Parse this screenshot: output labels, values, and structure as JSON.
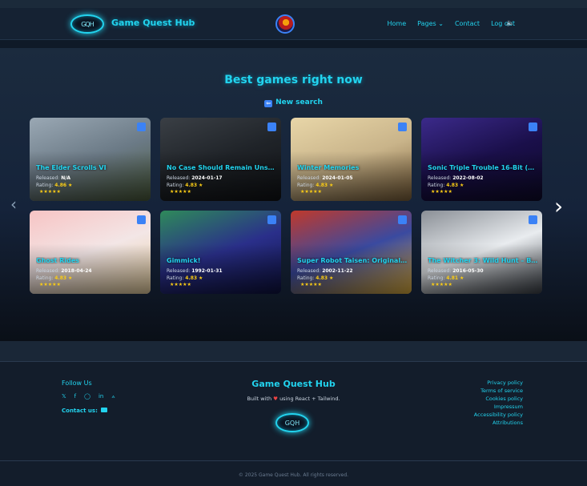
{
  "header": {
    "logo_text": "GQH",
    "brand": "Game Quest Hub",
    "nav": [
      "Home",
      "Pages",
      "Contact",
      "Log out"
    ],
    "pages_chevron": "⌄",
    "sound_icon": "🔈"
  },
  "hero": {
    "title": "Best games right now",
    "new_search": "New search",
    "prev_arrow": "‹",
    "next_arrow": "›"
  },
  "games": [
    {
      "title": "The Elder Scrolls VI",
      "released_label": "Released:",
      "released": "N/A",
      "rating_label": "Rating:",
      "rating": "4.86",
      "star": "★",
      "stars": "★★★★★",
      "colors": [
        "#6b7a86",
        "#9aa8b4",
        "#4a5a3a"
      ]
    },
    {
      "title": "No Case Should Remain Unso…",
      "released_label": "Released:",
      "released": "2024-01-17",
      "rating_label": "Rating:",
      "rating": "4.83",
      "star": "★",
      "stars": "★★★★★",
      "colors": [
        "#1f2328",
        "#3a3f45",
        "#101215"
      ]
    },
    {
      "title": "Winter Memories",
      "released_label": "Released:",
      "released": "2024-01-05",
      "rating_label": "Rating:",
      "rating": "4.83",
      "star": "★",
      "stars": "★★★★★",
      "colors": [
        "#c9b48a",
        "#e8d6a8",
        "#7a5f3a"
      ]
    },
    {
      "title": "Sonic Triple Trouble 16-Bit (N…",
      "released_label": "Released:",
      "released": "2022-08-02",
      "rating_label": "Rating:",
      "rating": "4.83",
      "star": "★",
      "stars": "★★★★★",
      "colors": [
        "#1a0f4a",
        "#3b2a8a",
        "#0e0a2a"
      ]
    },
    {
      "title": "Ghost Rides",
      "released_label": "Released:",
      "released": "2018-04-24",
      "rating_label": "Rating:",
      "rating": "4.83",
      "star": "★",
      "stars": "★★★★★",
      "colors": [
        "#f3e6e6",
        "#f7c4c4",
        "#e8d0a0"
      ]
    },
    {
      "title": "Gimmick!",
      "released_label": "Released:",
      "released": "1992-01-31",
      "rating_label": "Rating:",
      "rating": "4.83",
      "star": "★",
      "stars": "★★★★★",
      "colors": [
        "#2a2f8a",
        "#2e8a5a",
        "#0e1240"
      ]
    },
    {
      "title": "Super Robot Taisen: Original …",
      "released_label": "Released:",
      "released": "2002-11-22",
      "rating_label": "Rating:",
      "rating": "4.83",
      "star": "★",
      "stars": "★★★★★",
      "colors": [
        "#3a4aa0",
        "#c0392b",
        "#e2b13c"
      ]
    },
    {
      "title": "The Witcher 3: Wild Hunt – Bl…",
      "released_label": "Released:",
      "released": "2016-05-30",
      "rating_label": "Rating:",
      "rating": "4.81",
      "star": "★",
      "stars": "★★★★★",
      "colors": [
        "#e9ecef",
        "#8a8f96",
        "#3a3f46"
      ]
    }
  ],
  "footer": {
    "follow": "Follow Us",
    "socials": [
      "𝕏",
      "f",
      "◯",
      "in",
      "⟑"
    ],
    "contact": "Contact us:",
    "brand": "Game Quest Hub",
    "built_prefix": "Built with",
    "heart": "♥",
    "built_suffix": "using React + Tailwind.",
    "logo_text": "GQH",
    "policies": [
      "Privacy policy",
      "Terms of service",
      "Cookies policy",
      "Impressum",
      "Accessibility policy",
      "Attributions"
    ],
    "copyright": "© 2025 Game Quest Hub. All rights reserved."
  },
  "colors": {
    "accent": "#22d3ee",
    "background": "#0f1a28",
    "rating": "#facc15",
    "badge": "#3b82f6"
  }
}
